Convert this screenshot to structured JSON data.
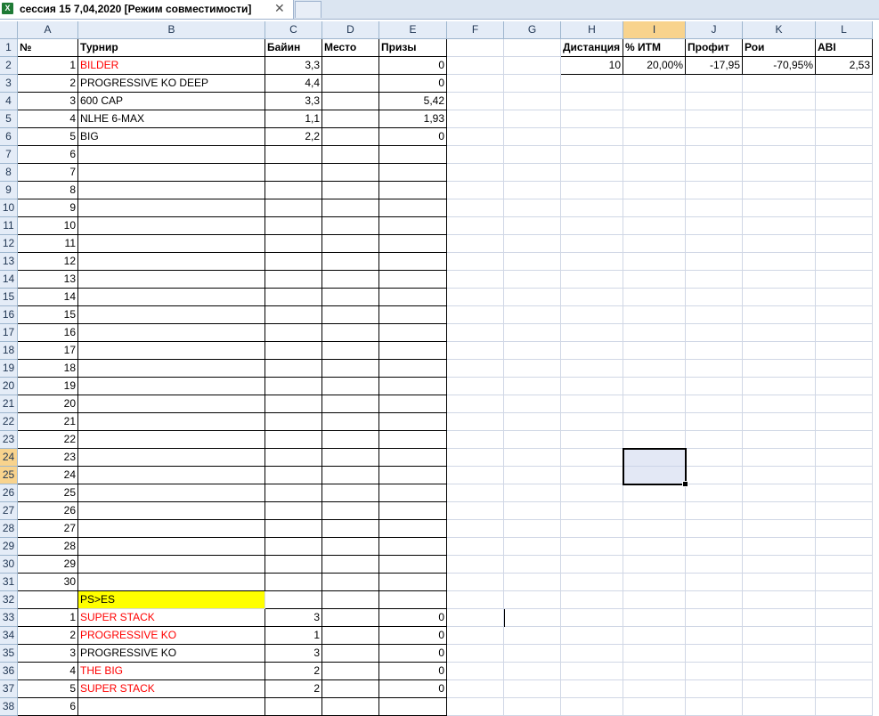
{
  "window": {
    "tab_title": "сессия 15 7,04,2020  [Режим совместимости]",
    "close_glyph": "✕",
    "excel_icon_glyph": "X"
  },
  "sheet": {
    "columns": [
      "A",
      "B",
      "C",
      "D",
      "E",
      "F",
      "G",
      "H",
      "I",
      "J",
      "K",
      "L"
    ],
    "selected_column": "I",
    "selected_rows": [
      "24",
      "25"
    ],
    "rows": [
      "1",
      "2",
      "3",
      "4",
      "5",
      "6",
      "7",
      "8",
      "9",
      "10",
      "11",
      "12",
      "13",
      "14",
      "15",
      "16",
      "17",
      "18",
      "19",
      "20",
      "21",
      "22",
      "23",
      "24",
      "25",
      "26",
      "27",
      "28",
      "29",
      "30",
      "31",
      "32",
      "33",
      "34",
      "35",
      "36",
      "37",
      "38"
    ],
    "cells": {
      "A1": "№",
      "B1": "Турнир",
      "C1": "Байин",
      "D1": "Место",
      "E1": "Призы",
      "H1": "Дистанция",
      "I1": "% ИТМ",
      "J1": "Профит",
      "K1": "Рои",
      "L1": "ABI",
      "A2": "1",
      "B2": "BILDER",
      "C2": "3,3",
      "E2": "0",
      "H2": "10",
      "I2": "20,00%",
      "J2": "-17,95",
      "K2": "-70,95%",
      "L2": "2,53",
      "A3": "2",
      "B3": "PROGRESSIVE KO DEEP",
      "C3": "4,4",
      "E3": "0",
      "A4": "3",
      "B4": "600 CAP",
      "C4": "3,3",
      "E4": "5,42",
      "A5": "4",
      "B5": "NLHE 6-MAX",
      "C5": "1,1",
      "E5": "1,93",
      "A6": "5",
      "B6": "BIG",
      "C6": "2,2",
      "E6": "0",
      "A7": "6",
      "A8": "7",
      "A9": "8",
      "A10": "9",
      "A11": "10",
      "A12": "11",
      "A13": "12",
      "A14": "13",
      "A15": "14",
      "A16": "15",
      "A17": "16",
      "A18": "17",
      "A19": "18",
      "A20": "19",
      "A21": "20",
      "A22": "21",
      "A23": "22",
      "A24": "23",
      "A25": "24",
      "A26": "25",
      "A27": "26",
      "A28": "27",
      "A29": "28",
      "A30": "29",
      "A31": "30",
      "B32": "PS>ES",
      "A33": "1",
      "B33": "SUPER STACK",
      "C33": "3",
      "E33": "0",
      "A34": "2",
      "B34": "PROGRESSIVE KO",
      "C34": "1",
      "E34": "0",
      "A35": "3",
      "B35": "PROGRESSIVE KO",
      "C35": "3",
      "E35": "0",
      "A36": "4",
      "B36": "THE BIG",
      "C36": "2",
      "E36": "0",
      "A37": "5",
      "B37": "SUPER STACK",
      "C37": "2",
      "E37": "0",
      "A38": "6"
    },
    "red_cells": [
      "B2",
      "B33",
      "B34",
      "B36",
      "B37"
    ],
    "yellow_cells": [
      "B32"
    ],
    "colors": {
      "header_bg": "#e4ecf7",
      "header_selected": "#f8d38d",
      "red_text": "#ff0000",
      "yellow_fill": "#ffff00"
    }
  }
}
